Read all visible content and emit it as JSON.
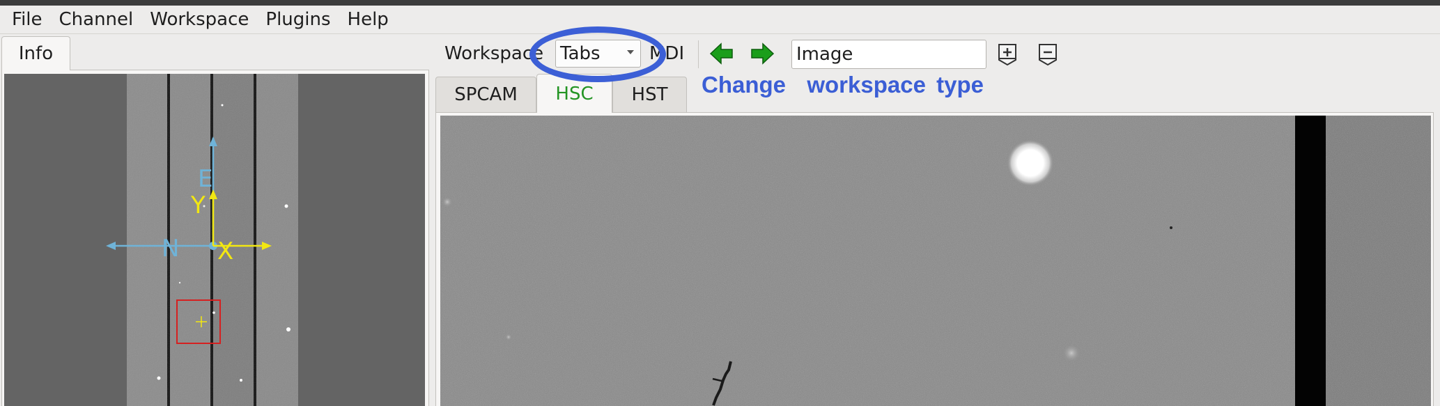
{
  "menubar": {
    "items": [
      "File",
      "Channel",
      "Workspace",
      "Plugins",
      "Help"
    ]
  },
  "info_panel": {
    "tab_label": "Info",
    "compass": {
      "east": "E",
      "north": "N",
      "x_axis": "X",
      "y_axis": "Y"
    },
    "colors": {
      "compass": "#6fb3d8",
      "xy_axes": "#f2e711",
      "view_box": "#d62020"
    }
  },
  "toolbar": {
    "workspace_label": "Workspace",
    "workspace_type": "Tabs",
    "mdi_label": "MDI",
    "channel_name": "Image",
    "icons": [
      "prev-channel-icon",
      "next-channel-icon",
      "add-channel-icon",
      "delete-channel-icon"
    ]
  },
  "annotation": {
    "text": "Change  workspace type",
    "color": "#3b5ed5"
  },
  "tabs": {
    "items": [
      "SPCAM",
      "HSC",
      "HST"
    ],
    "active": "HSC",
    "active_color": "#239423"
  }
}
